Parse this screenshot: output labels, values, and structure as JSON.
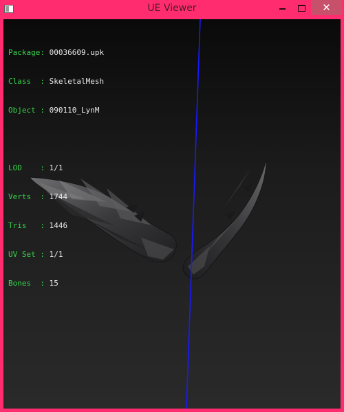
{
  "window": {
    "title": "UE Viewer",
    "close_symbol": "✕"
  },
  "info": {
    "package": {
      "key": "Package: ",
      "value": "00036609.upk"
    },
    "class": {
      "key": "Class  : ",
      "value": "SkeletalMesh"
    },
    "object": {
      "key": "Object : ",
      "value": "090110_LynM"
    },
    "lod": {
      "key": "LOD    : ",
      "value": "1/1"
    },
    "verts": {
      "key": "Verts  : ",
      "value": "1744"
    },
    "tris": {
      "key": "Tris   : ",
      "value": "1446"
    },
    "uvset": {
      "key": "UV Set : ",
      "value": "1/1"
    },
    "bones": {
      "key": "Bones  : ",
      "value": "15"
    }
  },
  "colors": {
    "titlebar": "#ff2d6f",
    "info_key": "#35d44a",
    "info_value": "#e8e8e8",
    "axis_line": "#1a1aff"
  },
  "icons": {
    "app": "app-window-icon",
    "minimize": "minimize-icon",
    "maximize": "maximize-icon",
    "close": "close-icon"
  }
}
